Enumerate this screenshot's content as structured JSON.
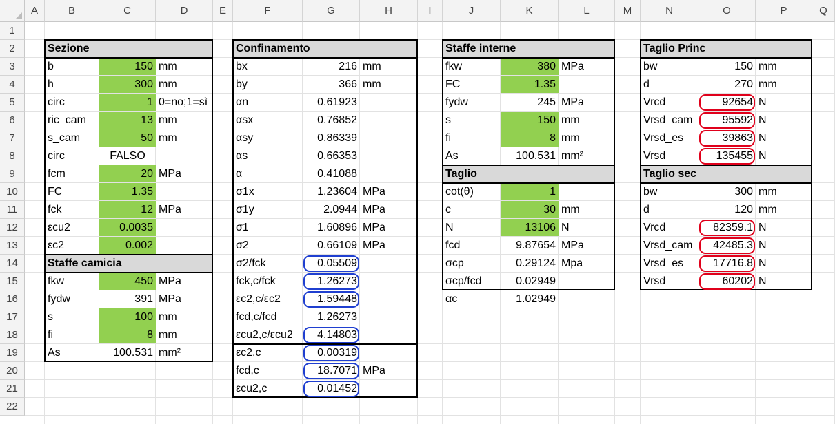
{
  "spreadsheet": {
    "columns": [
      "A",
      "B",
      "C",
      "D",
      "E",
      "F",
      "G",
      "H",
      "I",
      "J",
      "K",
      "L",
      "M",
      "N",
      "O",
      "P",
      "Q"
    ],
    "rows": [
      "1",
      "2",
      "3",
      "4",
      "5",
      "6",
      "7",
      "8",
      "9",
      "10",
      "11",
      "12",
      "13",
      "14",
      "15",
      "16",
      "17",
      "18",
      "19",
      "20",
      "21",
      "22"
    ],
    "colors": {
      "input_fill": "#92d050",
      "header_fill": "#d9d9d9",
      "highlight_blue": "#1f3fd0",
      "highlight_red": "#e0001b"
    }
  },
  "sezione": {
    "title": "Sezione",
    "rows": [
      {
        "label": "b",
        "value": "150",
        "unit": "mm"
      },
      {
        "label": "h",
        "value": "300",
        "unit": "mm"
      },
      {
        "label": "circ",
        "value": "1",
        "unit": "0=no;1=sì"
      },
      {
        "label": "ric_cam",
        "value": "13",
        "unit": "mm"
      },
      {
        "label": "s_cam",
        "value": "50",
        "unit": "mm"
      },
      {
        "label": "circ",
        "value": "FALSO",
        "unit": ""
      },
      {
        "label": "fcm",
        "value": "20",
        "unit": "MPa"
      },
      {
        "label": "FC",
        "value": "1.35",
        "unit": ""
      },
      {
        "label": "fck",
        "value": "12",
        "unit": "MPa"
      },
      {
        "label": "εcu2",
        "value": "0.0035",
        "unit": ""
      },
      {
        "label": "εc2",
        "value": "0.002",
        "unit": ""
      }
    ]
  },
  "staffe_camicia": {
    "title": "Staffe camicia",
    "rows": [
      {
        "label": "fkw",
        "value": "450",
        "unit": "MPa"
      },
      {
        "label": "fydw",
        "value": "391",
        "unit": "MPa"
      },
      {
        "label": "s",
        "value": "100",
        "unit": "mm"
      },
      {
        "label": "fi",
        "value": "8",
        "unit": "mm"
      },
      {
        "label": "As",
        "value": "100.531",
        "unit": "mm²"
      }
    ]
  },
  "confinamento": {
    "title": "Confinamento",
    "rows": [
      {
        "label": "bx",
        "value": "216",
        "unit": "mm"
      },
      {
        "label": "by",
        "value": "366",
        "unit": "mm"
      },
      {
        "label": "αn",
        "value": "0.61923",
        "unit": ""
      },
      {
        "label": "αsx",
        "value": "0.76852",
        "unit": ""
      },
      {
        "label": "αsy",
        "value": "0.86339",
        "unit": ""
      },
      {
        "label": "αs",
        "value": "0.66353",
        "unit": ""
      },
      {
        "label": "α",
        "value": "0.41088",
        "unit": ""
      },
      {
        "label": "σ1x",
        "value": "1.23604",
        "unit": "MPa"
      },
      {
        "label": "σ1y",
        "value": "2.0944",
        "unit": "MPa"
      },
      {
        "label": "σ1",
        "value": "1.60896",
        "unit": "MPa"
      },
      {
        "label": "σ2",
        "value": "0.66109",
        "unit": "MPa"
      },
      {
        "label": "σ2/fck",
        "value": "0.05509",
        "unit": ""
      },
      {
        "label": "fck,c/fck",
        "value": "1.26273",
        "unit": ""
      },
      {
        "label": "εc2,c/εc2",
        "value": "1.59448",
        "unit": ""
      },
      {
        "label": "fcd,c/fcd",
        "value": "1.26273",
        "unit": ""
      },
      {
        "label": "εcu2,c/εcu2",
        "value": "4.14803",
        "unit": ""
      },
      {
        "label": "εc2,c",
        "value": "0.00319",
        "unit": ""
      },
      {
        "label": "fcd,c",
        "value": "18.7071",
        "unit": "MPa"
      },
      {
        "label": "εcu2,c",
        "value": "0.01452",
        "unit": ""
      }
    ]
  },
  "staffe_interne": {
    "title": "Staffe interne",
    "rows": [
      {
        "label": "fkw",
        "value": "380",
        "unit": "MPa"
      },
      {
        "label": "FC",
        "value": "1.35",
        "unit": ""
      },
      {
        "label": "fydw",
        "value": "245",
        "unit": "MPa"
      },
      {
        "label": "s",
        "value": "150",
        "unit": "mm"
      },
      {
        "label": "fi",
        "value": "8",
        "unit": "mm"
      },
      {
        "label": "As",
        "value": "100.531",
        "unit": "mm²"
      }
    ]
  },
  "taglio": {
    "title": "Taglio",
    "rows": [
      {
        "label": "cot(θ)",
        "value": "1",
        "unit": ""
      },
      {
        "label": "c",
        "value": "30",
        "unit": "mm"
      },
      {
        "label": "N",
        "value": "13106",
        "unit": "N"
      },
      {
        "label": "fcd",
        "value": "9.87654",
        "unit": "MPa"
      },
      {
        "label": "σcp",
        "value": "0.29124",
        "unit": "Mpa"
      },
      {
        "label": "σcp/fcd",
        "value": "0.02949",
        "unit": ""
      },
      {
        "label": "αc",
        "value": "1.02949",
        "unit": ""
      }
    ]
  },
  "taglio_princ": {
    "title": "Taglio Princ",
    "rows": [
      {
        "label": "bw",
        "value": "150",
        "unit": "mm"
      },
      {
        "label": "d",
        "value": "270",
        "unit": "mm"
      },
      {
        "label": "Vrcd",
        "value": "92654",
        "unit": "N"
      },
      {
        "label": "Vrsd_cam",
        "value": "95592",
        "unit": "N"
      },
      {
        "label": "Vrsd_es",
        "value": "39863",
        "unit": "N"
      },
      {
        "label": "Vrsd",
        "value": "135455",
        "unit": "N"
      }
    ]
  },
  "taglio_sec": {
    "title": "Taglio sec",
    "rows": [
      {
        "label": "bw",
        "value": "300",
        "unit": "mm"
      },
      {
        "label": "d",
        "value": "120",
        "unit": "mm"
      },
      {
        "label": "Vrcd",
        "value": "82359.1",
        "unit": "N"
      },
      {
        "label": "Vrsd_cam",
        "value": "42485.3",
        "unit": "N"
      },
      {
        "label": "Vrsd_es",
        "value": "17716.8",
        "unit": "N"
      },
      {
        "label": "Vrsd",
        "value": "60202",
        "unit": "N"
      }
    ]
  }
}
